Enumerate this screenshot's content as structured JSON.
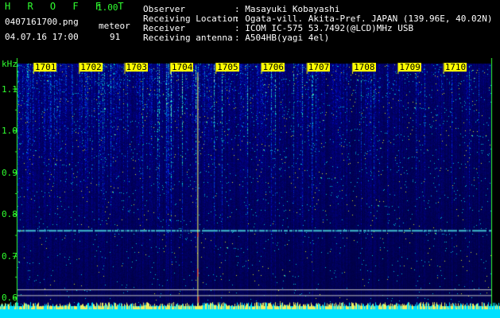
{
  "app": {
    "name": "H R O F F T",
    "version": "1.00"
  },
  "file": {
    "name": "0407161700.png",
    "datetime": "04.07.16 17:00"
  },
  "meteor": {
    "label": "meteor",
    "count": "91"
  },
  "info": [
    {
      "label": "Observer",
      "value": ": Masayuki Kobayashi"
    },
    {
      "label": "Receiving Location",
      "value": ": Ogata-vill. Akita-Pref. JAPAN (139.96E, 40.02N)"
    },
    {
      "label": "Receiver",
      "value": ": ICOM IC-575 53.7492(@LCD)MHz USB"
    },
    {
      "label": "Receiving antenna",
      "value": ": A504HB(yagi 4el)"
    }
  ],
  "chart_data": {
    "type": "heatmap",
    "ylabel": "kHz",
    "y_ticks": [
      "1.1",
      "1.0",
      "0.9",
      "0.8",
      "0.7",
      "0.6"
    ],
    "y_values": [
      1.1,
      1.0,
      0.9,
      0.8,
      0.7,
      0.6
    ],
    "ylim": [
      0.58,
      1.16
    ],
    "x_ticks": [
      "1701",
      "1702",
      "1703",
      "1704",
      "1705",
      "1706",
      "1707",
      "1708",
      "1709",
      "1710"
    ],
    "x_values": [
      1701,
      1702,
      1703,
      1704,
      1705,
      1706,
      1707,
      1708,
      1709,
      1710
    ],
    "xlim": [
      1700.6,
      1711.0
    ],
    "colors": {
      "background": "#000080",
      "signal": "#00ffff",
      "peak": "#ffff00",
      "strong": "#ff2020"
    }
  }
}
